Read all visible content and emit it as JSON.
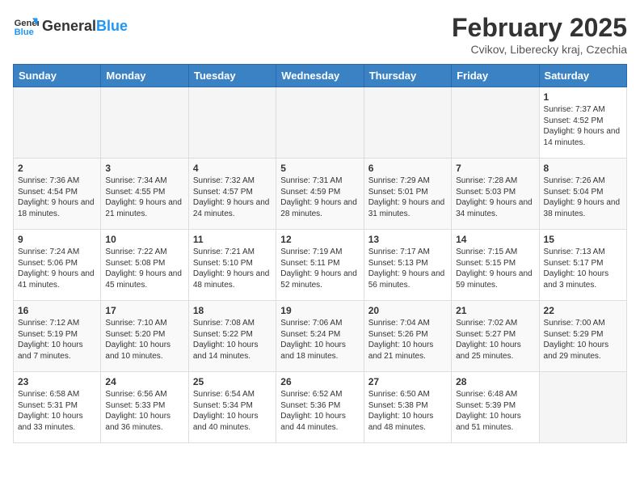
{
  "header": {
    "logo_general": "General",
    "logo_blue": "Blue",
    "month_title": "February 2025",
    "location": "Cvikov, Liberecky kraj, Czechia"
  },
  "weekdays": [
    "Sunday",
    "Monday",
    "Tuesday",
    "Wednesday",
    "Thursday",
    "Friday",
    "Saturday"
  ],
  "weeks": [
    [
      {
        "day": "",
        "info": ""
      },
      {
        "day": "",
        "info": ""
      },
      {
        "day": "",
        "info": ""
      },
      {
        "day": "",
        "info": ""
      },
      {
        "day": "",
        "info": ""
      },
      {
        "day": "",
        "info": ""
      },
      {
        "day": "1",
        "info": "Sunrise: 7:37 AM\nSunset: 4:52 PM\nDaylight: 9 hours and 14 minutes."
      }
    ],
    [
      {
        "day": "2",
        "info": "Sunrise: 7:36 AM\nSunset: 4:54 PM\nDaylight: 9 hours and 18 minutes."
      },
      {
        "day": "3",
        "info": "Sunrise: 7:34 AM\nSunset: 4:55 PM\nDaylight: 9 hours and 21 minutes."
      },
      {
        "day": "4",
        "info": "Sunrise: 7:32 AM\nSunset: 4:57 PM\nDaylight: 9 hours and 24 minutes."
      },
      {
        "day": "5",
        "info": "Sunrise: 7:31 AM\nSunset: 4:59 PM\nDaylight: 9 hours and 28 minutes."
      },
      {
        "day": "6",
        "info": "Sunrise: 7:29 AM\nSunset: 5:01 PM\nDaylight: 9 hours and 31 minutes."
      },
      {
        "day": "7",
        "info": "Sunrise: 7:28 AM\nSunset: 5:03 PM\nDaylight: 9 hours and 34 minutes."
      },
      {
        "day": "8",
        "info": "Sunrise: 7:26 AM\nSunset: 5:04 PM\nDaylight: 9 hours and 38 minutes."
      }
    ],
    [
      {
        "day": "9",
        "info": "Sunrise: 7:24 AM\nSunset: 5:06 PM\nDaylight: 9 hours and 41 minutes."
      },
      {
        "day": "10",
        "info": "Sunrise: 7:22 AM\nSunset: 5:08 PM\nDaylight: 9 hours and 45 minutes."
      },
      {
        "day": "11",
        "info": "Sunrise: 7:21 AM\nSunset: 5:10 PM\nDaylight: 9 hours and 48 minutes."
      },
      {
        "day": "12",
        "info": "Sunrise: 7:19 AM\nSunset: 5:11 PM\nDaylight: 9 hours and 52 minutes."
      },
      {
        "day": "13",
        "info": "Sunrise: 7:17 AM\nSunset: 5:13 PM\nDaylight: 9 hours and 56 minutes."
      },
      {
        "day": "14",
        "info": "Sunrise: 7:15 AM\nSunset: 5:15 PM\nDaylight: 9 hours and 59 minutes."
      },
      {
        "day": "15",
        "info": "Sunrise: 7:13 AM\nSunset: 5:17 PM\nDaylight: 10 hours and 3 minutes."
      }
    ],
    [
      {
        "day": "16",
        "info": "Sunrise: 7:12 AM\nSunset: 5:19 PM\nDaylight: 10 hours and 7 minutes."
      },
      {
        "day": "17",
        "info": "Sunrise: 7:10 AM\nSunset: 5:20 PM\nDaylight: 10 hours and 10 minutes."
      },
      {
        "day": "18",
        "info": "Sunrise: 7:08 AM\nSunset: 5:22 PM\nDaylight: 10 hours and 14 minutes."
      },
      {
        "day": "19",
        "info": "Sunrise: 7:06 AM\nSunset: 5:24 PM\nDaylight: 10 hours and 18 minutes."
      },
      {
        "day": "20",
        "info": "Sunrise: 7:04 AM\nSunset: 5:26 PM\nDaylight: 10 hours and 21 minutes."
      },
      {
        "day": "21",
        "info": "Sunrise: 7:02 AM\nSunset: 5:27 PM\nDaylight: 10 hours and 25 minutes."
      },
      {
        "day": "22",
        "info": "Sunrise: 7:00 AM\nSunset: 5:29 PM\nDaylight: 10 hours and 29 minutes."
      }
    ],
    [
      {
        "day": "23",
        "info": "Sunrise: 6:58 AM\nSunset: 5:31 PM\nDaylight: 10 hours and 33 minutes."
      },
      {
        "day": "24",
        "info": "Sunrise: 6:56 AM\nSunset: 5:33 PM\nDaylight: 10 hours and 36 minutes."
      },
      {
        "day": "25",
        "info": "Sunrise: 6:54 AM\nSunset: 5:34 PM\nDaylight: 10 hours and 40 minutes."
      },
      {
        "day": "26",
        "info": "Sunrise: 6:52 AM\nSunset: 5:36 PM\nDaylight: 10 hours and 44 minutes."
      },
      {
        "day": "27",
        "info": "Sunrise: 6:50 AM\nSunset: 5:38 PM\nDaylight: 10 hours and 48 minutes."
      },
      {
        "day": "28",
        "info": "Sunrise: 6:48 AM\nSunset: 5:39 PM\nDaylight: 10 hours and 51 minutes."
      },
      {
        "day": "",
        "info": ""
      }
    ]
  ]
}
